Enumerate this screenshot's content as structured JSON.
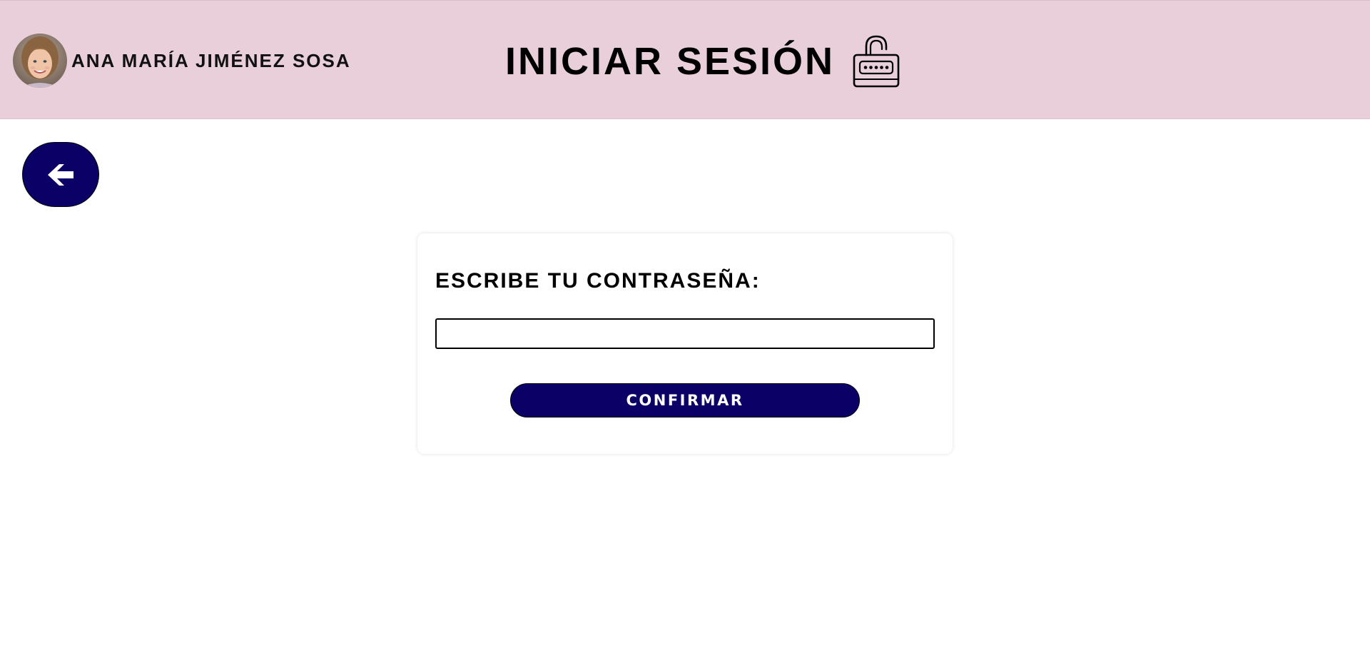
{
  "header": {
    "user_name": "ANA MARÍA JIMÉNEZ SOSA",
    "avatar_icon": "child-avatar-photo",
    "title": "INICIAR SESIÓN",
    "title_icon": "unlocked-padlock-password-icon"
  },
  "navigation": {
    "back_icon": "arrow-left-icon"
  },
  "login_form": {
    "label": "ESCRIBE TU CONTRASEÑA:",
    "password_value": "",
    "confirm_label": "CONFIRMAR"
  },
  "colors": {
    "header_background": "#e9cfd9",
    "button_background": "#0a0066",
    "button_text": "#ffffff"
  }
}
